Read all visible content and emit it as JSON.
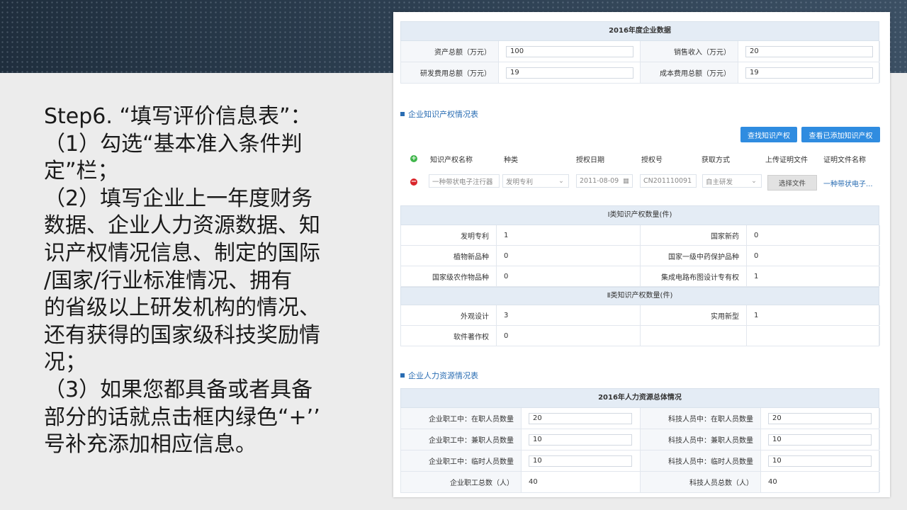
{
  "slide": {
    "lines": [
      "Step6. “填写评价信息表”：",
      "（1）勾选“基本准入条件判",
      "定”栏；",
      "（2）填写企业上一年度财务",
      "数据、企业人力资源数据、知",
      "识产权情况信息、制定的国际",
      "/国家/行业标准情况、拥有",
      "的省级以上研发机构的情况、",
      "还有获得的国家级科技奖励情",
      "况；",
      "（3）如果您都具备或者具备",
      "部分的话就点击框内绿色“+’’",
      "号补充添加相应信息。"
    ]
  },
  "finance": {
    "title": "2016年度企业数据",
    "rows": [
      {
        "l1": "资产总额（万元）",
        "v1": "100",
        "l2": "销售收入（万元）",
        "v2": "20"
      },
      {
        "l1": "研发费用总额（万元）",
        "v1": "19",
        "l2": "成本费用总额（万元）",
        "v2": "19"
      }
    ]
  },
  "ip_section": {
    "title": "企业知识产权情况表",
    "btn_find": "查找知识产权",
    "btn_view": "查看已添加知识产权",
    "headers": [
      "知识产权名称",
      "种类",
      "授权日期",
      "授权号",
      "获取方式",
      "上传证明文件",
      "证明文件名称"
    ],
    "row": {
      "name": "一种带状电子注行器",
      "kind": "发明专利",
      "date": "2011-08-09",
      "number": "CN201110091",
      "method": "自主研发",
      "file_btn": "选择文件",
      "file_name": "一种带状电子..."
    }
  },
  "ip_class1": {
    "title": "Ⅰ类知识产权数量(件)",
    "rows": [
      {
        "l1": "发明专利",
        "v1": "1",
        "l2": "国家新药",
        "v2": "0"
      },
      {
        "l1": "植物新品种",
        "v1": "0",
        "l2": "国家一级中药保护品种",
        "v2": "0"
      },
      {
        "l1": "国家级农作物品种",
        "v1": "0",
        "l2": "集成电路布图设计专有权",
        "v2": "1"
      }
    ]
  },
  "ip_class2": {
    "title": "Ⅱ类知识产权数量(件)",
    "rows": [
      {
        "l1": "外观设计",
        "v1": "3",
        "l2": "实用新型",
        "v2": "1"
      },
      {
        "l1": "软件著作权",
        "v1": "0",
        "l2": "",
        "v2": ""
      }
    ]
  },
  "hr_section": {
    "title": "企业人力资源情况表",
    "subtitle": "2016年人力资源总体情况",
    "rows": [
      {
        "l1": "企业职工中：在职人员数量",
        "v1": "20",
        "l2": "科技人员中：在职人员数量",
        "v2": "20"
      },
      {
        "l1": "企业职工中：兼职人员数量",
        "v1": "10",
        "l2": "科技人员中：兼职人员数量",
        "v2": "10"
      },
      {
        "l1": "企业职工中：临时人员数量",
        "v1": "10",
        "l2": "科技人员中：临时人员数量",
        "v2": "10"
      },
      {
        "l1": "企业职工总数（人）",
        "v1": "40",
        "l2": "科技人员总数（人）",
        "v2": "40"
      }
    ]
  }
}
